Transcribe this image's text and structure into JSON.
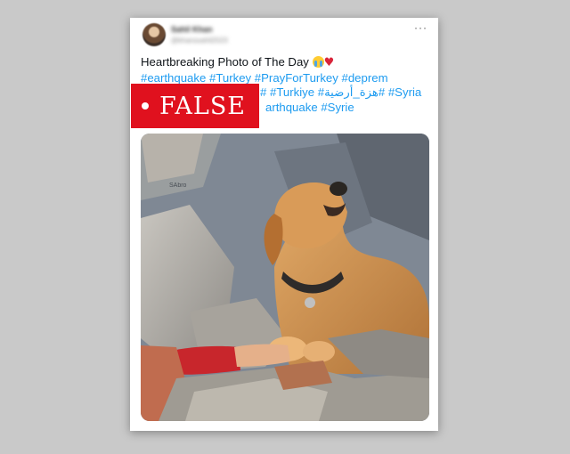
{
  "tweet": {
    "display_name": "Sahil Khan",
    "handle": "@khanssahil2023",
    "more_icon": "more-icon",
    "line1_text": "Heartbreaking Photo of The Day",
    "line1_emojis": "😭💔",
    "hashtags_line1": "#earthquake #Turkey #PrayForTurkey #deprem",
    "hashtags_line2": "# #Turkiye #هزة_أرضية# #Syria",
    "hashtags_line3": "arthquake #Syrie"
  },
  "fact_check_label": {
    "text": "FALSE",
    "color": "#e0111e"
  },
  "photo": {
    "watermark": "SAbro"
  },
  "colors": {
    "hashtag": "#1d9bf0",
    "background": "#c9c9c9"
  }
}
